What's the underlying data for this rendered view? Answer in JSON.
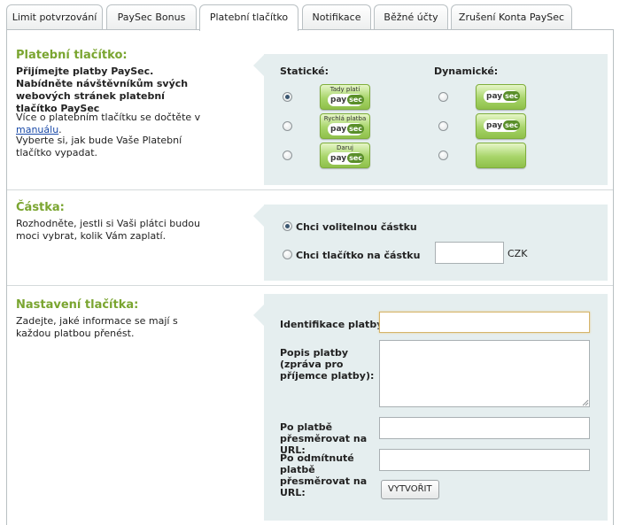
{
  "tabs": [
    {
      "label": "Limit potvrzování",
      "active": false
    },
    {
      "label": "PaySec Bonus",
      "active": false
    },
    {
      "label": "Platební tlačítko",
      "active": true
    },
    {
      "label": "Notifikace",
      "active": false
    },
    {
      "label": "Běžné účty",
      "active": false
    },
    {
      "label": "Zrušení Konta PaySec",
      "active": false
    }
  ],
  "button_section": {
    "title": "Platební tlačítko:",
    "intro_bold": "Přijímejte platby PaySec. Nabídněte návštěvníkům svých webových stránek platební tlačítko PaySec",
    "more_prefix": "Více o platebním tlačítku se dočtěte v",
    "more_link": "manuálu",
    "more_suffix": ".",
    "choose_text": "Vyberte si, jak bude Vaše Platební tlačítko vypadat.",
    "static_label": "Statické:",
    "dynamic_label": "Dynamické:",
    "static_buttons": [
      {
        "caption": "Tady platí",
        "selected": true
      },
      {
        "caption": "Rychlá platba",
        "selected": false
      },
      {
        "caption": "Daruj",
        "selected": false
      }
    ],
    "dynamic_buttons": [
      {
        "has_logo": true,
        "selected": false
      },
      {
        "has_logo": true,
        "selected": false
      },
      {
        "has_logo": false,
        "selected": false
      }
    ],
    "logo_pay": "pay",
    "logo_sec": "sec"
  },
  "amount_section": {
    "title": "Částka:",
    "description": "Rozhodněte, jestli si Vaši plátci budou moci vybrat, kolik Vám zaplatí.",
    "option_optional": "Chci volitelnou částku",
    "option_fixed": "Chci tlačítko na částku",
    "amount_value": "",
    "currency": "CZK"
  },
  "settings_section": {
    "title": "Nastavení tlačítka:",
    "description": "Zadejte, jaké informace se mají s každou platbou přenést.",
    "field_id_label": "Identifikace platby:",
    "field_id_value": "",
    "field_desc_label": "Popis platby (zpráva pro příjemce platby):",
    "field_desc_value": "",
    "field_success_label": "Po platbě přesměrovat na URL:",
    "field_success_value": "",
    "field_fail_label": "Po odmítnuté platbě přesměrovat na URL:",
    "field_fail_value": "",
    "create_button": "VYTVOŘIT"
  },
  "colors": {
    "accent_green": "#7aa530",
    "panel_bg": "#e5eeef",
    "link": "#1a4aa8"
  }
}
